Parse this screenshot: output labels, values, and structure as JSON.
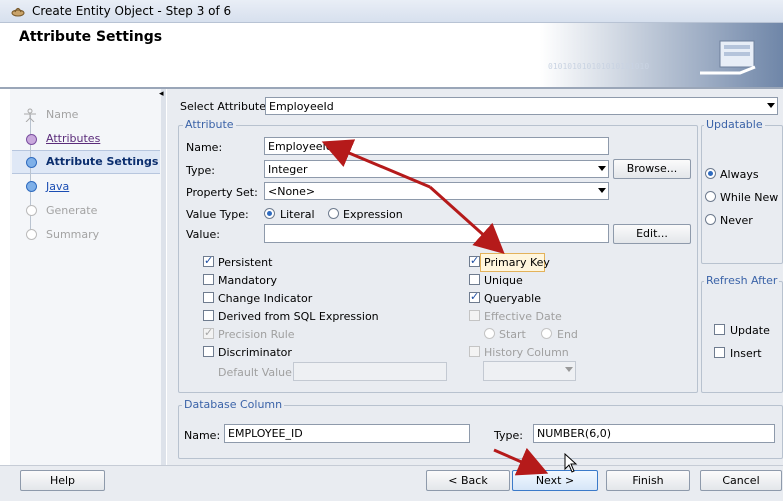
{
  "window": {
    "title": "Create Entity Object - Step 3 of 6"
  },
  "header": {
    "title": "Attribute Settings"
  },
  "steps": [
    {
      "label": "Name",
      "state": "disabled"
    },
    {
      "label": "Attributes",
      "state": "done"
    },
    {
      "label": "Attribute Settings",
      "state": "current"
    },
    {
      "label": "Java",
      "state": "link"
    },
    {
      "label": "Generate",
      "state": "disabled"
    },
    {
      "label": "Summary",
      "state": "disabled"
    }
  ],
  "select_attribute": {
    "label": "Select Attribute",
    "value": "EmployeeId"
  },
  "attribute": {
    "group_title": "Attribute",
    "name_label": "Name:",
    "name_value": "EmployeeId",
    "type_label": "Type:",
    "type_value": "Integer",
    "browse_label": "Browse...",
    "property_set_label": "Property Set:",
    "property_set_value": "<None>",
    "value_type_label": "Value Type:",
    "literal_label": "Literal",
    "expression_label": "Expression",
    "value_label": "Value:",
    "value_value": "",
    "edit_label": "Edit...",
    "checkboxes_left": [
      {
        "label": "Persistent",
        "checked": true,
        "disabled": false
      },
      {
        "label": "Mandatory",
        "checked": false,
        "disabled": false
      },
      {
        "label": "Change Indicator",
        "checked": false,
        "disabled": false
      },
      {
        "label": "Derived from SQL Expression",
        "checked": false,
        "disabled": false
      },
      {
        "label": "Precision Rule",
        "checked": true,
        "disabled": true
      },
      {
        "label": "Discriminator",
        "checked": false,
        "disabled": false
      }
    ],
    "default_value_label": "Default Value:",
    "checkboxes_right": [
      {
        "label": "Primary Key",
        "checked": true,
        "disabled": false
      },
      {
        "label": "Unique",
        "checked": false,
        "disabled": false
      },
      {
        "label": "Queryable",
        "checked": true,
        "disabled": false
      },
      {
        "label": "Effective Date",
        "checked": false,
        "disabled": true
      }
    ],
    "start_label": "Start",
    "end_label": "End",
    "history_column_label": "History Column"
  },
  "updatable": {
    "title": "Updatable",
    "options": [
      "Always",
      "While New",
      "Never"
    ],
    "selected": "Always"
  },
  "refresh_after": {
    "title": "Refresh After",
    "update_label": "Update",
    "insert_label": "Insert"
  },
  "database_column": {
    "title": "Database Column",
    "name_label": "Name:",
    "name_value": "EMPLOYEE_ID",
    "type_label": "Type:",
    "type_value": "NUMBER(6,0)"
  },
  "footer": {
    "help": "Help",
    "back": "< Back",
    "next": "Next >",
    "finish": "Finish",
    "cancel": "Cancel"
  },
  "colors": {
    "annotation_arrow": "#b51a1a",
    "accent": "#3b63a8"
  }
}
